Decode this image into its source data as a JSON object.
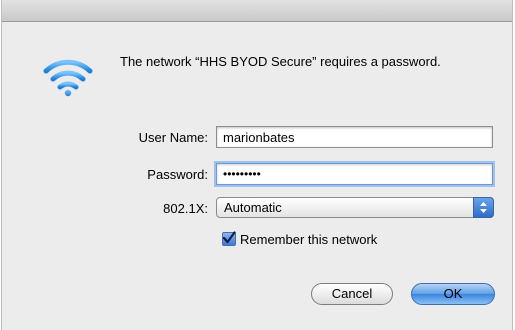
{
  "dialog": {
    "message": "The network “HHS BYOD Secure” requires a password.",
    "icon": "wifi-icon",
    "username": {
      "label": "User Name:",
      "value": "marionbates"
    },
    "password": {
      "label": "Password:",
      "value": "•••••••••"
    },
    "eap": {
      "label": "802.1X:",
      "selected": "Automatic"
    },
    "remember": {
      "label": "Remember this network",
      "checked": true
    },
    "buttons": {
      "cancel": "Cancel",
      "ok": "OK"
    }
  },
  "colors": {
    "accent": "#3b84e0",
    "wifi": "#2b8de8"
  }
}
